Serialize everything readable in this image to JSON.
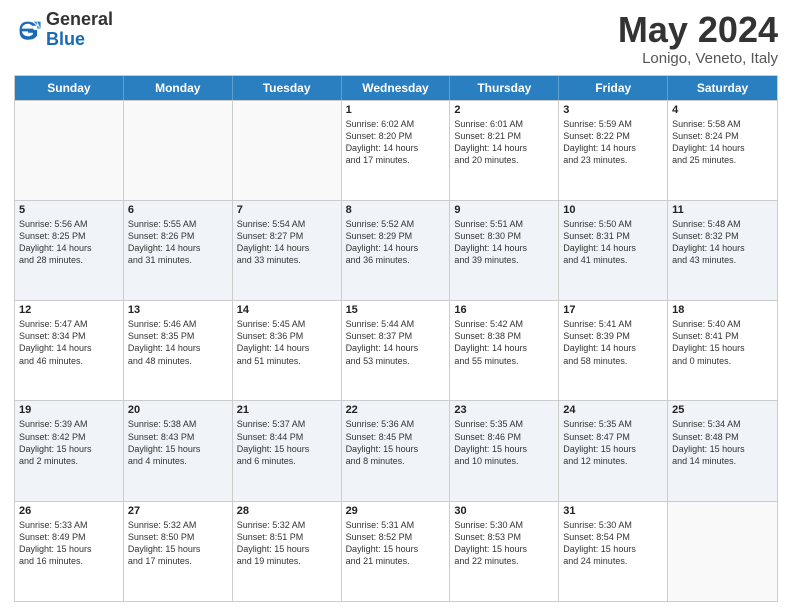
{
  "logo": {
    "line1": "General",
    "line2": "Blue"
  },
  "title": "May 2024",
  "subtitle": "Lonigo, Veneto, Italy",
  "headers": [
    "Sunday",
    "Monday",
    "Tuesday",
    "Wednesday",
    "Thursday",
    "Friday",
    "Saturday"
  ],
  "rows": [
    [
      {
        "day": "",
        "info": ""
      },
      {
        "day": "",
        "info": ""
      },
      {
        "day": "",
        "info": ""
      },
      {
        "day": "1",
        "info": "Sunrise: 6:02 AM\nSunset: 8:20 PM\nDaylight: 14 hours\nand 17 minutes."
      },
      {
        "day": "2",
        "info": "Sunrise: 6:01 AM\nSunset: 8:21 PM\nDaylight: 14 hours\nand 20 minutes."
      },
      {
        "day": "3",
        "info": "Sunrise: 5:59 AM\nSunset: 8:22 PM\nDaylight: 14 hours\nand 23 minutes."
      },
      {
        "day": "4",
        "info": "Sunrise: 5:58 AM\nSunset: 8:24 PM\nDaylight: 14 hours\nand 25 minutes."
      }
    ],
    [
      {
        "day": "5",
        "info": "Sunrise: 5:56 AM\nSunset: 8:25 PM\nDaylight: 14 hours\nand 28 minutes."
      },
      {
        "day": "6",
        "info": "Sunrise: 5:55 AM\nSunset: 8:26 PM\nDaylight: 14 hours\nand 31 minutes."
      },
      {
        "day": "7",
        "info": "Sunrise: 5:54 AM\nSunset: 8:27 PM\nDaylight: 14 hours\nand 33 minutes."
      },
      {
        "day": "8",
        "info": "Sunrise: 5:52 AM\nSunset: 8:29 PM\nDaylight: 14 hours\nand 36 minutes."
      },
      {
        "day": "9",
        "info": "Sunrise: 5:51 AM\nSunset: 8:30 PM\nDaylight: 14 hours\nand 39 minutes."
      },
      {
        "day": "10",
        "info": "Sunrise: 5:50 AM\nSunset: 8:31 PM\nDaylight: 14 hours\nand 41 minutes."
      },
      {
        "day": "11",
        "info": "Sunrise: 5:48 AM\nSunset: 8:32 PM\nDaylight: 14 hours\nand 43 minutes."
      }
    ],
    [
      {
        "day": "12",
        "info": "Sunrise: 5:47 AM\nSunset: 8:34 PM\nDaylight: 14 hours\nand 46 minutes."
      },
      {
        "day": "13",
        "info": "Sunrise: 5:46 AM\nSunset: 8:35 PM\nDaylight: 14 hours\nand 48 minutes."
      },
      {
        "day": "14",
        "info": "Sunrise: 5:45 AM\nSunset: 8:36 PM\nDaylight: 14 hours\nand 51 minutes."
      },
      {
        "day": "15",
        "info": "Sunrise: 5:44 AM\nSunset: 8:37 PM\nDaylight: 14 hours\nand 53 minutes."
      },
      {
        "day": "16",
        "info": "Sunrise: 5:42 AM\nSunset: 8:38 PM\nDaylight: 14 hours\nand 55 minutes."
      },
      {
        "day": "17",
        "info": "Sunrise: 5:41 AM\nSunset: 8:39 PM\nDaylight: 14 hours\nand 58 minutes."
      },
      {
        "day": "18",
        "info": "Sunrise: 5:40 AM\nSunset: 8:41 PM\nDaylight: 15 hours\nand 0 minutes."
      }
    ],
    [
      {
        "day": "19",
        "info": "Sunrise: 5:39 AM\nSunset: 8:42 PM\nDaylight: 15 hours\nand 2 minutes."
      },
      {
        "day": "20",
        "info": "Sunrise: 5:38 AM\nSunset: 8:43 PM\nDaylight: 15 hours\nand 4 minutes."
      },
      {
        "day": "21",
        "info": "Sunrise: 5:37 AM\nSunset: 8:44 PM\nDaylight: 15 hours\nand 6 minutes."
      },
      {
        "day": "22",
        "info": "Sunrise: 5:36 AM\nSunset: 8:45 PM\nDaylight: 15 hours\nand 8 minutes."
      },
      {
        "day": "23",
        "info": "Sunrise: 5:35 AM\nSunset: 8:46 PM\nDaylight: 15 hours\nand 10 minutes."
      },
      {
        "day": "24",
        "info": "Sunrise: 5:35 AM\nSunset: 8:47 PM\nDaylight: 15 hours\nand 12 minutes."
      },
      {
        "day": "25",
        "info": "Sunrise: 5:34 AM\nSunset: 8:48 PM\nDaylight: 15 hours\nand 14 minutes."
      }
    ],
    [
      {
        "day": "26",
        "info": "Sunrise: 5:33 AM\nSunset: 8:49 PM\nDaylight: 15 hours\nand 16 minutes."
      },
      {
        "day": "27",
        "info": "Sunrise: 5:32 AM\nSunset: 8:50 PM\nDaylight: 15 hours\nand 17 minutes."
      },
      {
        "day": "28",
        "info": "Sunrise: 5:32 AM\nSunset: 8:51 PM\nDaylight: 15 hours\nand 19 minutes."
      },
      {
        "day": "29",
        "info": "Sunrise: 5:31 AM\nSunset: 8:52 PM\nDaylight: 15 hours\nand 21 minutes."
      },
      {
        "day": "30",
        "info": "Sunrise: 5:30 AM\nSunset: 8:53 PM\nDaylight: 15 hours\nand 22 minutes."
      },
      {
        "day": "31",
        "info": "Sunrise: 5:30 AM\nSunset: 8:54 PM\nDaylight: 15 hours\nand 24 minutes."
      },
      {
        "day": "",
        "info": ""
      }
    ]
  ]
}
